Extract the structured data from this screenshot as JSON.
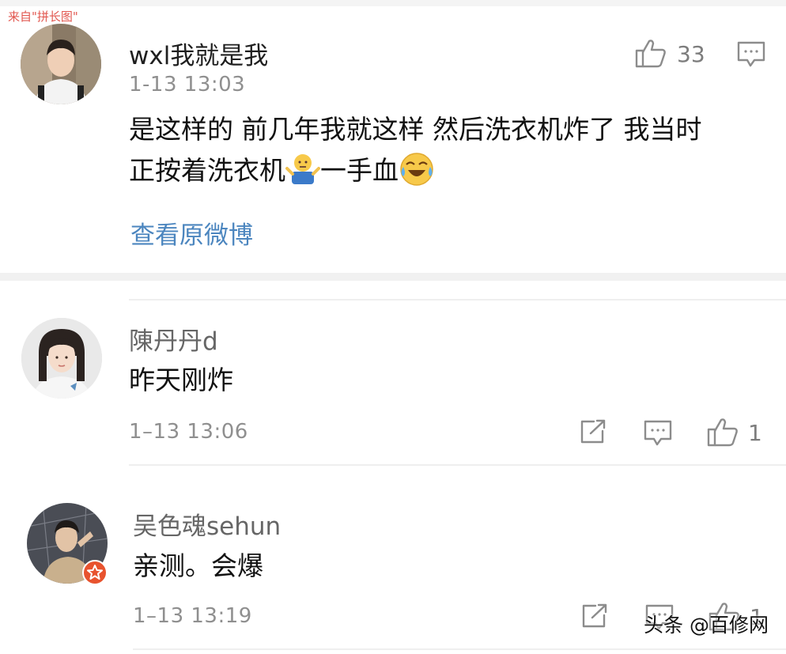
{
  "stamp": "来自\"拼长图\"",
  "main_comment": {
    "user": "wxl我就是我",
    "time": "1-13 13:03",
    "text_line1": "是这样的 前几年我就这样 然后洗衣机炸了 我当时",
    "text_line2_part1": "正按着洗衣机",
    "emoji1": "shrug-emoji",
    "text_line2_part2": "一手血",
    "emoji2": "crying-laughing-emoji",
    "likes": "33",
    "view_original_label": "查看原微博"
  },
  "replies": [
    {
      "user": "陳丹丹d",
      "text": "昨天刚炸",
      "time": "1–13 13:06",
      "likes": "1"
    },
    {
      "user": "吴色魂sehun",
      "text": "亲测。会爆",
      "time": "1–13 13:19",
      "likes": "1"
    }
  ],
  "watermark": "头条 @百修网",
  "colors": {
    "link": "#4c86bf",
    "badge": "#e8532e",
    "stamp": "#e2574f"
  }
}
